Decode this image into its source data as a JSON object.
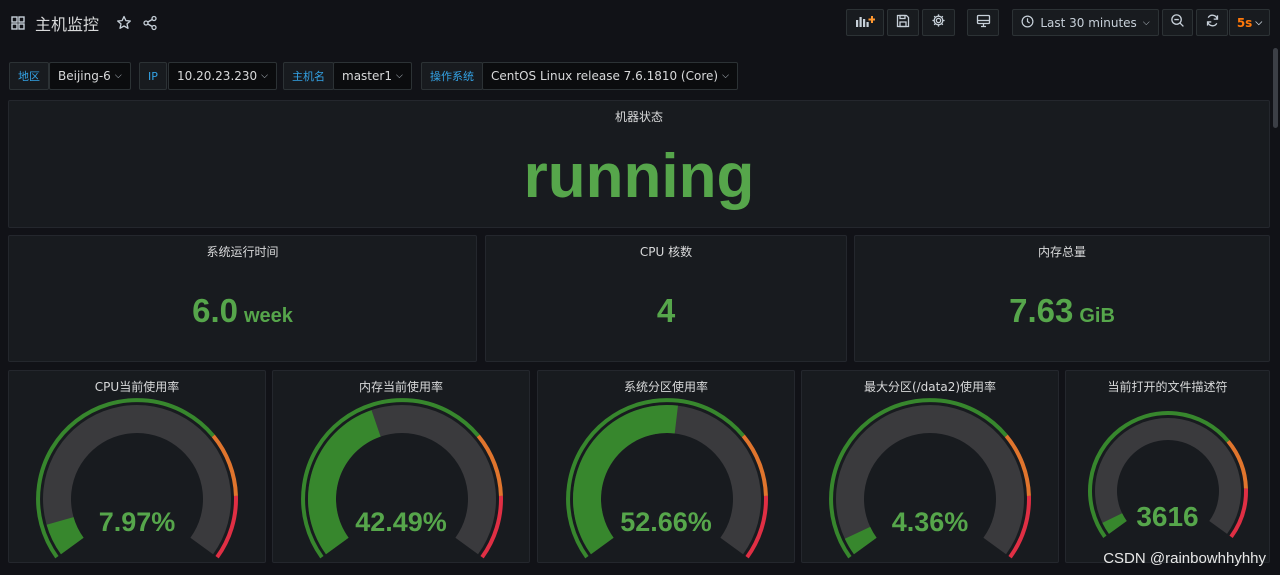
{
  "header": {
    "title": "主机监控",
    "time_range": "Last 30 minutes",
    "refresh_interval": "5s"
  },
  "variables": [
    {
      "label": "地区",
      "value": "Beijing-6"
    },
    {
      "label": "IP",
      "value": "10.20.23.230"
    },
    {
      "label": "主机名",
      "value": "master1"
    },
    {
      "label": "操作系统",
      "value": "CentOS Linux release 7.6.1810 (Core)"
    }
  ],
  "status_panel": {
    "title": "机器状态",
    "value": "running"
  },
  "stats": [
    {
      "title": "系统运行时间",
      "value": "6.0",
      "unit": "week"
    },
    {
      "title": "CPU 核数",
      "value": "4",
      "unit": ""
    },
    {
      "title": "内存总量",
      "value": "7.63",
      "unit": "GiB"
    }
  ],
  "gauges": [
    {
      "title": "CPU当前使用率",
      "display": "7.97%",
      "fraction": 0.0797
    },
    {
      "title": "内存当前使用率",
      "display": "42.49%",
      "fraction": 0.4249
    },
    {
      "title": "系统分区使用率",
      "display": "52.66%",
      "fraction": 0.5266
    },
    {
      "title": "最大分区(/data2)使用率",
      "display": "4.36%",
      "fraction": 0.0436
    },
    {
      "title": "当前打开的文件描述符",
      "display": "3616",
      "fraction": 0.04
    }
  ],
  "colors": {
    "ok": "#37872d",
    "ok_text": "#56a64b",
    "warn": "#e0752d",
    "crit": "#e02f44",
    "track": "#3a3a3d"
  },
  "watermark": "CSDN @rainbowhhyhhy"
}
